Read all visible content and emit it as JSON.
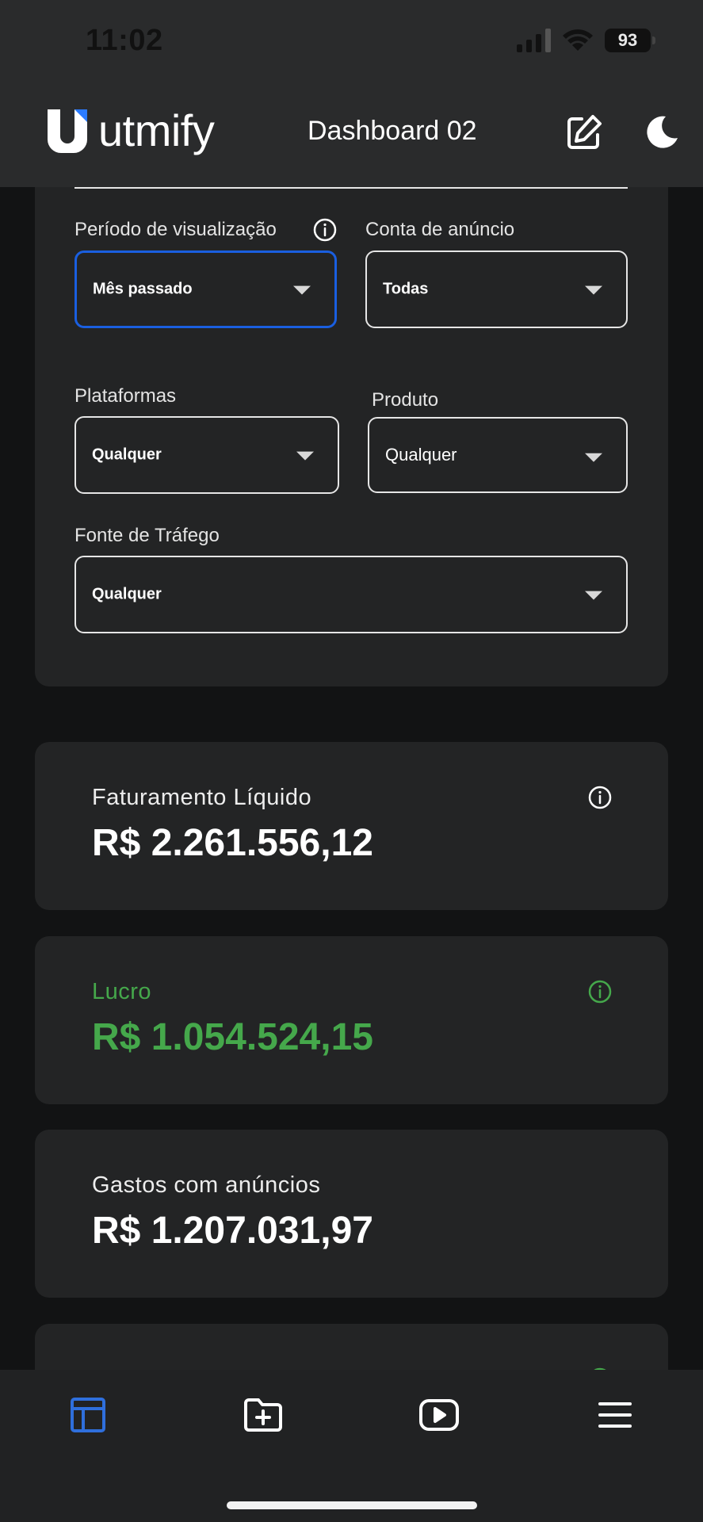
{
  "status_bar": {
    "time": "11:02",
    "battery": "93"
  },
  "header": {
    "brand": "utmify",
    "title": "Dashboard 02",
    "edit_icon": "edit-icon",
    "theme_icon": "moon-icon"
  },
  "filters": {
    "period": {
      "label": "Período de visualização",
      "value": "Mês passado"
    },
    "ad_account": {
      "label": "Conta de anúncio",
      "value": "Todas"
    },
    "platforms": {
      "label": "Plataformas",
      "value": "Qualquer"
    },
    "product": {
      "label": "Produto",
      "value": "Qualquer"
    },
    "traffic_source": {
      "label": "Fonte de Tráfego",
      "value": "Qualquer"
    }
  },
  "metrics": [
    {
      "label": "Faturamento Líquido",
      "value": "R$ 2.261.556,12"
    },
    {
      "label": "Lucro",
      "value": "R$ 1.054.524,15"
    },
    {
      "label": "Gastos com anúncios",
      "value": "R$ 1.207.031,97"
    }
  ],
  "bottom_nav": [
    {
      "icon": "dashboard-icon",
      "active": true
    },
    {
      "icon": "folder-plus-icon",
      "active": false
    },
    {
      "icon": "video-play-icon",
      "active": false
    },
    {
      "icon": "menu-icon",
      "active": false
    }
  ],
  "colors": {
    "accent_blue": "#1a5fe0",
    "profit_green": "#45a84b",
    "card_bg": "#232425",
    "page_bg": "#121314"
  }
}
